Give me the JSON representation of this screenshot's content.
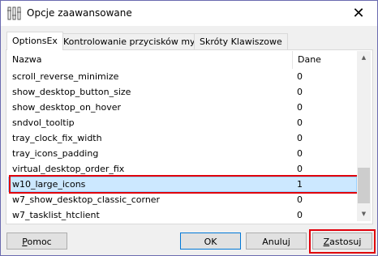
{
  "window": {
    "title": "Opcje zaawansowane",
    "close_glyph": "✕"
  },
  "tabs": [
    {
      "label": "OptionsEx",
      "active": true
    },
    {
      "label": "Kontrolowanie przycisków myszki",
      "active": false
    },
    {
      "label": "Skróty Klawiszowe",
      "active": false
    }
  ],
  "list": {
    "columns": {
      "name": "Nazwa",
      "value": "Dane"
    },
    "rows": [
      {
        "name": "scroll_reverse_minimize",
        "value": "0"
      },
      {
        "name": "show_desktop_button_size",
        "value": "0"
      },
      {
        "name": "show_desktop_on_hover",
        "value": "0"
      },
      {
        "name": "sndvol_tooltip",
        "value": "0"
      },
      {
        "name": "tray_clock_fix_width",
        "value": "0"
      },
      {
        "name": "tray_icons_padding",
        "value": "0"
      },
      {
        "name": "virtual_desktop_order_fix",
        "value": "0"
      },
      {
        "name": "w10_large_icons",
        "value": "1",
        "selected": true
      },
      {
        "name": "w7_show_desktop_classic_corner",
        "value": "0"
      },
      {
        "name": "w7_tasklist_htclient",
        "value": "0"
      }
    ],
    "highlight_color": "#e0000b"
  },
  "buttons": {
    "help_first": "P",
    "help_rest": "omoc",
    "ok": "OK",
    "cancel": "Anuluj",
    "apply_first": "Z",
    "apply_rest": "astosuj"
  },
  "icons": {
    "app": "settings-app-icon",
    "close": "close-icon",
    "scroll_up": "scroll-up-arrow-icon",
    "scroll_down": "scroll-down-arrow-icon"
  }
}
